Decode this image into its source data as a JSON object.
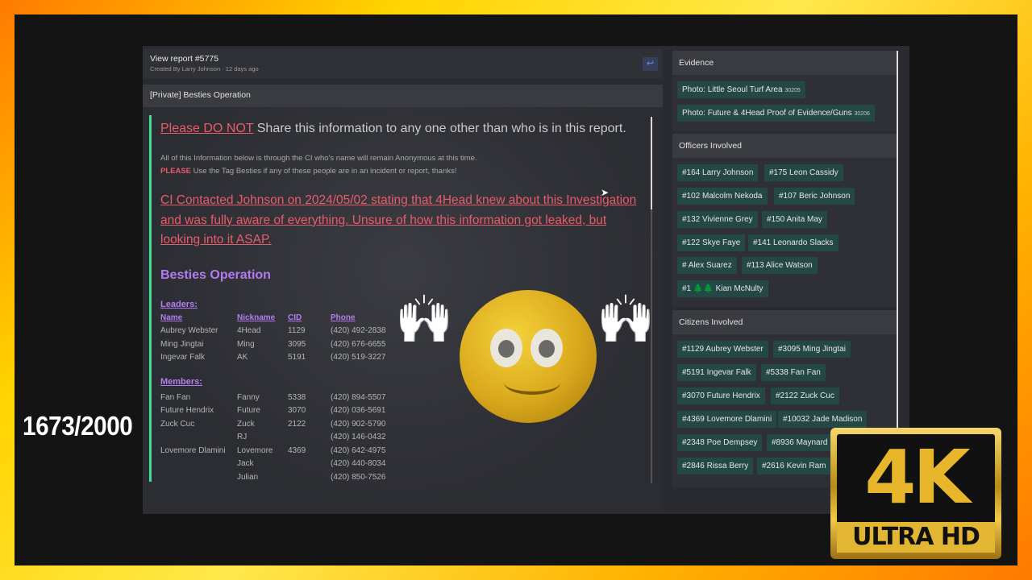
{
  "overlay": {
    "counter": "1673/2000",
    "badge_top": "4K",
    "badge_bottom": "ULTRA HD"
  },
  "report": {
    "title": "View report #5775",
    "meta": "Created By Larry Johnson · 12 days ago",
    "back_icon": "reply-arrow-icon",
    "subject": "[Private] Besties Operation",
    "warning_red": "Please DO NOT",
    "warning_rest": " Share this information to any one other than who is in this report.",
    "info_line1": "All of this Information below is through the CI who's name will remain Anonymous at this time.",
    "info_please": "PLEASE",
    "info_line2_rest": " Use the Tag Besties if any of these people are in an incident or report, thanks!",
    "alert": "CI Contacted Johnson on 2024/05/02 stating that 4Head knew about this Investigation and was fully aware of everything. Unsure of how this information got leaked, but looking into it ASAP.",
    "section_title": "Besties Operation",
    "leaders_label": "Leaders:",
    "columns": [
      "Name",
      "Nickname",
      "CID",
      "Phone"
    ],
    "leaders": [
      [
        "Aubrey Webster",
        "4Head",
        "1129",
        "(420) 492-2838"
      ],
      [
        "Ming Jingtai",
        "Ming",
        "3095",
        "(420) 676-6655"
      ],
      [
        "Ingevar Falk",
        "AK",
        "5191",
        "(420) 519-3227"
      ]
    ],
    "members_label": "Members:",
    "members": [
      [
        "Fan Fan",
        "Fanny",
        "5338",
        "(420) 894-5507"
      ],
      [
        "Future Hendrix",
        "Future",
        "3070",
        "(420) 036-5691"
      ],
      [
        "Zuck Cuc",
        "Zuck",
        "2122",
        "(420) 902-5790"
      ],
      [
        "",
        "RJ",
        "",
        "(420) 146-0432"
      ],
      [
        "Lovemore Dlamini",
        "Lovemore",
        "4369",
        "(420) 642-4975"
      ],
      [
        "",
        "Jack",
        "",
        "(420) 440-8034"
      ],
      [
        "",
        "Julian",
        "",
        "(420) 850-7526"
      ]
    ]
  },
  "evidence": {
    "title": "Evidence",
    "items": [
      {
        "label": "Photo: Little Seoul Turf Area",
        "id": "30205"
      },
      {
        "label": "Photo: Future & 4Head Proof of Evidence/Guns",
        "id": "30206"
      }
    ]
  },
  "officers": {
    "title": "Officers Involved",
    "items": [
      "#164 Larry Johnson",
      "#175 Leon Cassidy",
      "#102 Malcolm Nekoda",
      "#107 Beric Johnson",
      "#132 Vivienne Grey",
      "#150 Anita May",
      "#122 Skye Faye",
      "#141 Leonardo Slacks",
      "# Alex Suarez",
      "#113 Alice Watson",
      "#1 🌲🌲 Kian McNulty"
    ]
  },
  "citizens": {
    "title": "Citizens Involved",
    "items": [
      "#1129 Aubrey Webster",
      "#3095 Ming Jingtai",
      "#5191 Ingevar Falk",
      "#5338 Fan Fan",
      "#3070 Future Hendrix",
      "#2122 Zuck Cuc",
      "#4369 Lovemore Dlamini",
      "#10032 Jade Madison",
      "#2348 Poe Dempsey",
      "#8936 Maynard",
      "#2846 Rissa Berry",
      "#2616 Kevin Ram"
    ]
  }
}
